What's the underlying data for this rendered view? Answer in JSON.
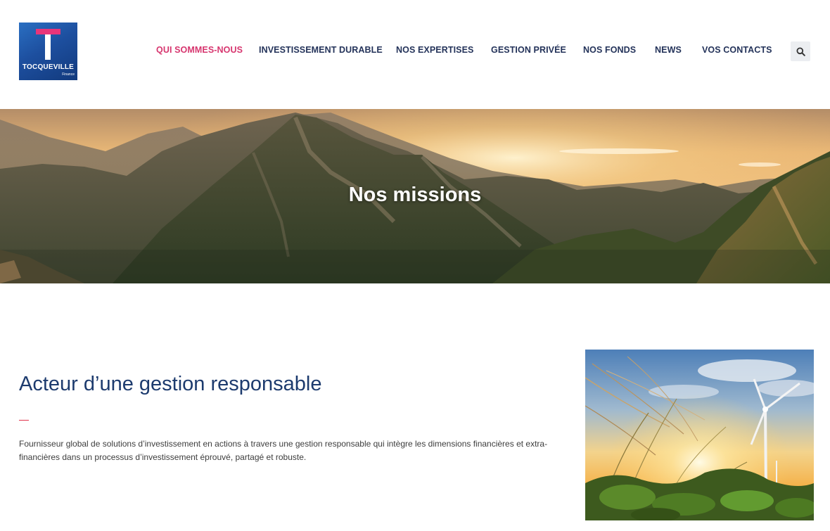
{
  "brand": {
    "logo_name": "TOCQUEVILLE",
    "logo_sub": "Finance",
    "primary_color": "#1d4f9f",
    "accent_color": "#d7366f"
  },
  "nav": {
    "items": [
      {
        "label": "QUI SOMMES-NOUS",
        "active": true
      },
      {
        "label": "INVESTISSEMENT DURABLE",
        "active": false
      },
      {
        "label": "NOS EXPERTISES",
        "active": false
      },
      {
        "label": "GESTION PRIVÉE",
        "active": false
      },
      {
        "label": "NOS FONDS",
        "active": false
      },
      {
        "label": "NEWS",
        "active": false
      },
      {
        "label": "VOS CONTACTS",
        "active": false
      }
    ],
    "search_icon": "search-icon"
  },
  "hero": {
    "title": "Nos missions"
  },
  "section": {
    "title": "Acteur d’une gestion responsable",
    "text": "Fournisseur global de solutions d’investissement en actions à travers une gestion responsable qui intègre les dimensions financières et extra-financières dans un processus d’investissement éprouvé, partagé et robuste."
  }
}
